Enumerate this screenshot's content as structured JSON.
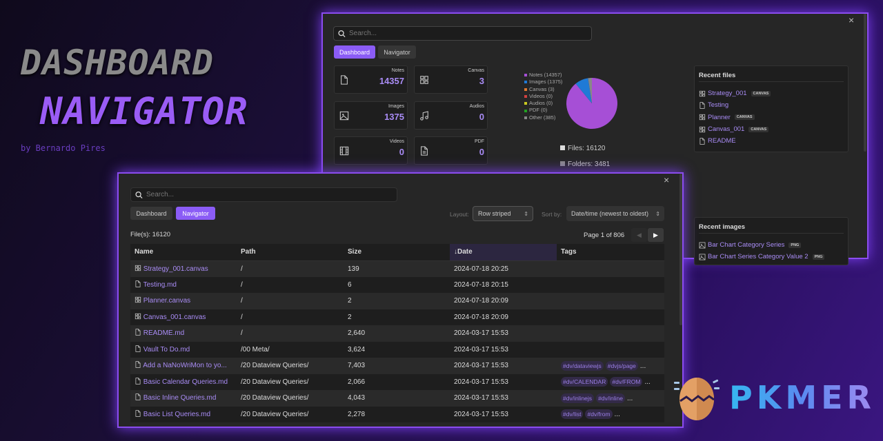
{
  "hero": {
    "title1": "DASHBOARD",
    "title2": "NAVIGATOR",
    "byline": "by Bernardo Pires"
  },
  "logo": {
    "text": "PKMER"
  },
  "dashboard_window": {
    "close": "×",
    "search_placeholder": "Search...",
    "tabs": [
      {
        "label": "Dashboard",
        "active": true
      },
      {
        "label": "Navigator",
        "active": false
      }
    ],
    "cards": [
      {
        "label": "Notes",
        "value": "14357",
        "icon": "file-icon"
      },
      {
        "label": "Canvas",
        "value": "3",
        "icon": "canvas-icon"
      },
      {
        "label": "Images",
        "value": "1375",
        "icon": "image-icon"
      },
      {
        "label": "Audios",
        "value": "0",
        "icon": "music-icon"
      },
      {
        "label": "Videos",
        "value": "0",
        "icon": "film-icon"
      },
      {
        "label": "PDF",
        "value": "0",
        "icon": "pdf-icon"
      }
    ],
    "chart_data": {
      "type": "pie",
      "categories": [
        "Notes",
        "Images",
        "Canvas",
        "Videos",
        "Audios",
        "PDF",
        "Other"
      ],
      "values": [
        14357,
        1375,
        3,
        0,
        0,
        0,
        385
      ],
      "legend": [
        "Notes (14357)",
        "Images (1375)",
        "Canvas (3)",
        "Videos (0)",
        "Audios (0)",
        "PDF (0)",
        "Other (385)"
      ],
      "colors": [
        "#a64fd6",
        "#1f7ad6",
        "#e07a30",
        "#d04040",
        "#c8c820",
        "#20a020",
        "#888888"
      ],
      "legend_position": "left"
    },
    "files_stat": "Files: 16120",
    "folders_stat": "Folders: 3481",
    "recent_files": {
      "title": "Recent files",
      "items": [
        {
          "name": "Strategy_001",
          "badge": "CANVAS",
          "icon": "canvas-icon"
        },
        {
          "name": "Testing",
          "badge": "",
          "icon": "file-icon"
        },
        {
          "name": "Planner",
          "badge": "CANVAS",
          "icon": "canvas-icon"
        },
        {
          "name": "Canvas_001",
          "badge": "CANVAS",
          "icon": "canvas-icon"
        },
        {
          "name": "README",
          "badge": "",
          "icon": "file-icon"
        }
      ]
    },
    "recent_images": {
      "title": "Recent images",
      "items": [
        {
          "name": "Bar Chart Category Series",
          "badge": "PNG"
        },
        {
          "name": "Bar Chart Series Category Value 2",
          "badge": "PNG"
        }
      ]
    }
  },
  "navigator_window": {
    "close": "×",
    "search_placeholder": "Search...",
    "tabs": [
      {
        "label": "Dashboard",
        "active": false
      },
      {
        "label": "Navigator",
        "active": true
      }
    ],
    "layout_label": "Layout:",
    "layout_value": "Row striped",
    "sort_label": "Sort by:",
    "sort_value": "Date/time (newest to oldest)",
    "file_count": "File(s): 16120",
    "page_info": "Page 1 of 806",
    "columns": [
      "Name",
      "Path",
      "Size",
      "↓Date",
      "Tags"
    ],
    "rows": [
      {
        "icon": "canvas-icon",
        "name": "Strategy_001.canvas",
        "path": "/",
        "size": "139",
        "date": "2024-07-18 20:25",
        "tags": []
      },
      {
        "icon": "file-icon",
        "name": "Testing.md",
        "path": "/",
        "size": "6",
        "date": "2024-07-18 20:15",
        "tags": []
      },
      {
        "icon": "canvas-icon",
        "name": "Planner.canvas",
        "path": "/",
        "size": "2",
        "date": "2024-07-18 20:09",
        "tags": []
      },
      {
        "icon": "canvas-icon",
        "name": "Canvas_001.canvas",
        "path": "/",
        "size": "2",
        "date": "2024-07-18 20:09",
        "tags": []
      },
      {
        "icon": "file-icon",
        "name": "README.md",
        "path": "/",
        "size": "2,640",
        "date": "2024-03-17 15:53",
        "tags": []
      },
      {
        "icon": "file-icon",
        "name": "Vault To Do.md",
        "path": "/00 Meta/",
        "size": "3,624",
        "date": "2024-03-17 15:53",
        "tags": []
      },
      {
        "icon": "file-icon",
        "name": "Add a NaNoWriMon to yo...",
        "path": "/20 Dataview Queries/",
        "size": "7,403",
        "date": "2024-03-17 15:53",
        "tags": [
          "#dv/dataviewjs",
          "#dvjs/page"
        ],
        "more": "..."
      },
      {
        "icon": "file-icon",
        "name": "Basic Calendar Queries.md",
        "path": "/20 Dataview Queries/",
        "size": "2,066",
        "date": "2024-03-17 15:53",
        "tags": [
          "#dv/CALENDAR",
          "#dv/FROM"
        ],
        "more": "..."
      },
      {
        "icon": "file-icon",
        "name": "Basic Inline Queries.md",
        "path": "/20 Dataview Queries/",
        "size": "4,043",
        "date": "2024-03-17 15:53",
        "tags": [
          "#dv/inlinejs",
          "#dv/inline"
        ],
        "more": "..."
      },
      {
        "icon": "file-icon",
        "name": "Basic List Queries.md",
        "path": "/20 Dataview Queries/",
        "size": "2,278",
        "date": "2024-03-17 15:53",
        "tags": [
          "#dv/list",
          "#dv/from"
        ],
        "more": "..."
      }
    ]
  }
}
